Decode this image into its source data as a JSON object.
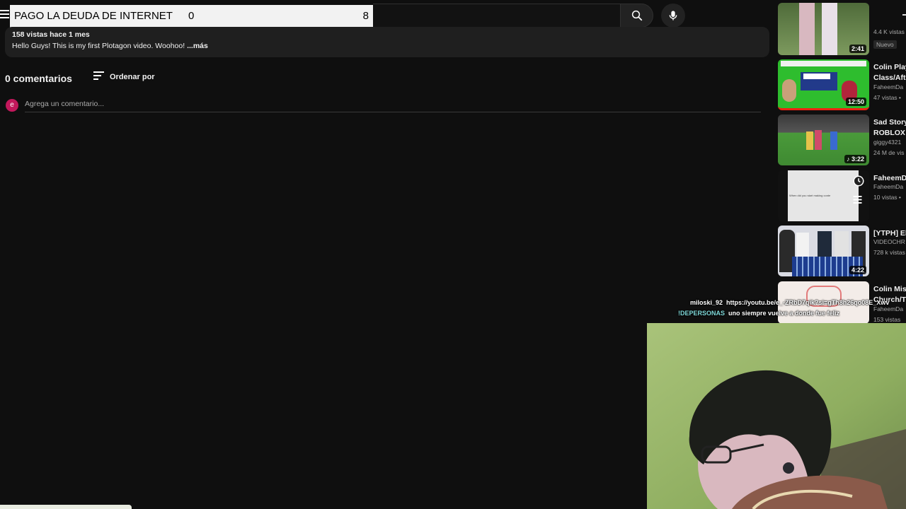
{
  "overlay": {
    "title": "PAGO LA DEUDA DE INTERNET",
    "count_a": "0",
    "count_b": "8"
  },
  "video": {
    "meta": "158 vistas  hace 1 mes",
    "description": "Hello Guys! This is my first Plotagon video. Woohoo! ",
    "more_label": "...más"
  },
  "comments": {
    "count_label": "0 comentarios",
    "sort_label": "Ordenar por",
    "avatar_letter": "e",
    "placeholder": "Agrega un comentario..."
  },
  "sidebar": {
    "items": [
      {
        "title": "",
        "channel": "4.4 K vistas",
        "views": "",
        "duration": "2:41",
        "badge": "Nuevo",
        "thumb_color": "#6a8a4a"
      },
      {
        "title": "Colin Play",
        "title2": "Class/Aft",
        "channel": "FaheemDa",
        "views": "47 vistas •",
        "duration": "12:50",
        "thumb_color": "#2eb52e"
      },
      {
        "title": "Sad Story",
        "title2": "ROBLOX (",
        "channel": "giggy4321",
        "views": "24 M de vis",
        "duration": "♪ 3:22",
        "thumb_color": "#3a8a3a"
      },
      {
        "title": "FaheemD",
        "title2": "",
        "channel": "FaheemDa",
        "views": "10 vistas •",
        "duration": "",
        "thumb_color": "#e8e8e8"
      },
      {
        "title": "[YTPH] El",
        "title2": "",
        "channel": "VIDEOCHR",
        "views": "728 k vistas",
        "duration": "4:22",
        "thumb_color": "#d8d8e0"
      },
      {
        "title": "Colin Mis",
        "title2": "Church/T",
        "channel": "FaheemDa",
        "views": "153 vistas",
        "duration": "",
        "thumb_color": "#f0e6e0"
      }
    ]
  },
  "thumb_overlay": {
    "thumb4_text": "When did you start making conte"
  },
  "chat": {
    "messages": [
      {
        "user": "miloski_92",
        "text": "https://youtu.be/e_-ZRbD7qik?si=gTh8h26qo08E_Xwv"
      },
      {
        "user": "!DEPERSONAS",
        "text": "uno siempre vuelve a donde fue feliz"
      }
    ]
  },
  "colors": {
    "background": "#0f0f0f",
    "surface": "#1f1f1f",
    "avatar": "#c2185b",
    "chat_user2": "#7fd8d8"
  }
}
